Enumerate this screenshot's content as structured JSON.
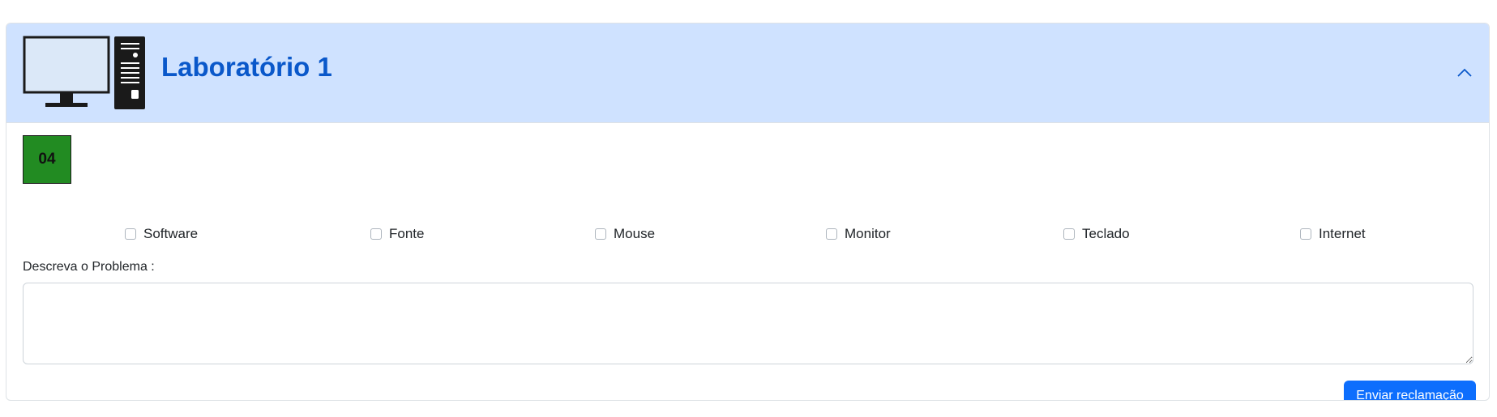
{
  "card": {
    "title": "Laboratório 1",
    "header_icon": "computer-icon",
    "collapse_icon": "chevron-up-icon",
    "accent_color": "#0a58ca",
    "header_bg": "#cfe2ff"
  },
  "machine": {
    "number": "04",
    "status_color": "#228b22"
  },
  "problems": [
    {
      "label": "Software",
      "checked": false
    },
    {
      "label": "Fonte",
      "checked": false
    },
    {
      "label": "Mouse",
      "checked": false
    },
    {
      "label": "Monitor",
      "checked": false
    },
    {
      "label": "Teclado",
      "checked": false
    },
    {
      "label": "Internet",
      "checked": false
    }
  ],
  "description": {
    "label": "Descreva o Problema :",
    "value": "",
    "placeholder": ""
  },
  "submit": {
    "label": "Enviar reclamação",
    "color": "#0d6efd"
  }
}
